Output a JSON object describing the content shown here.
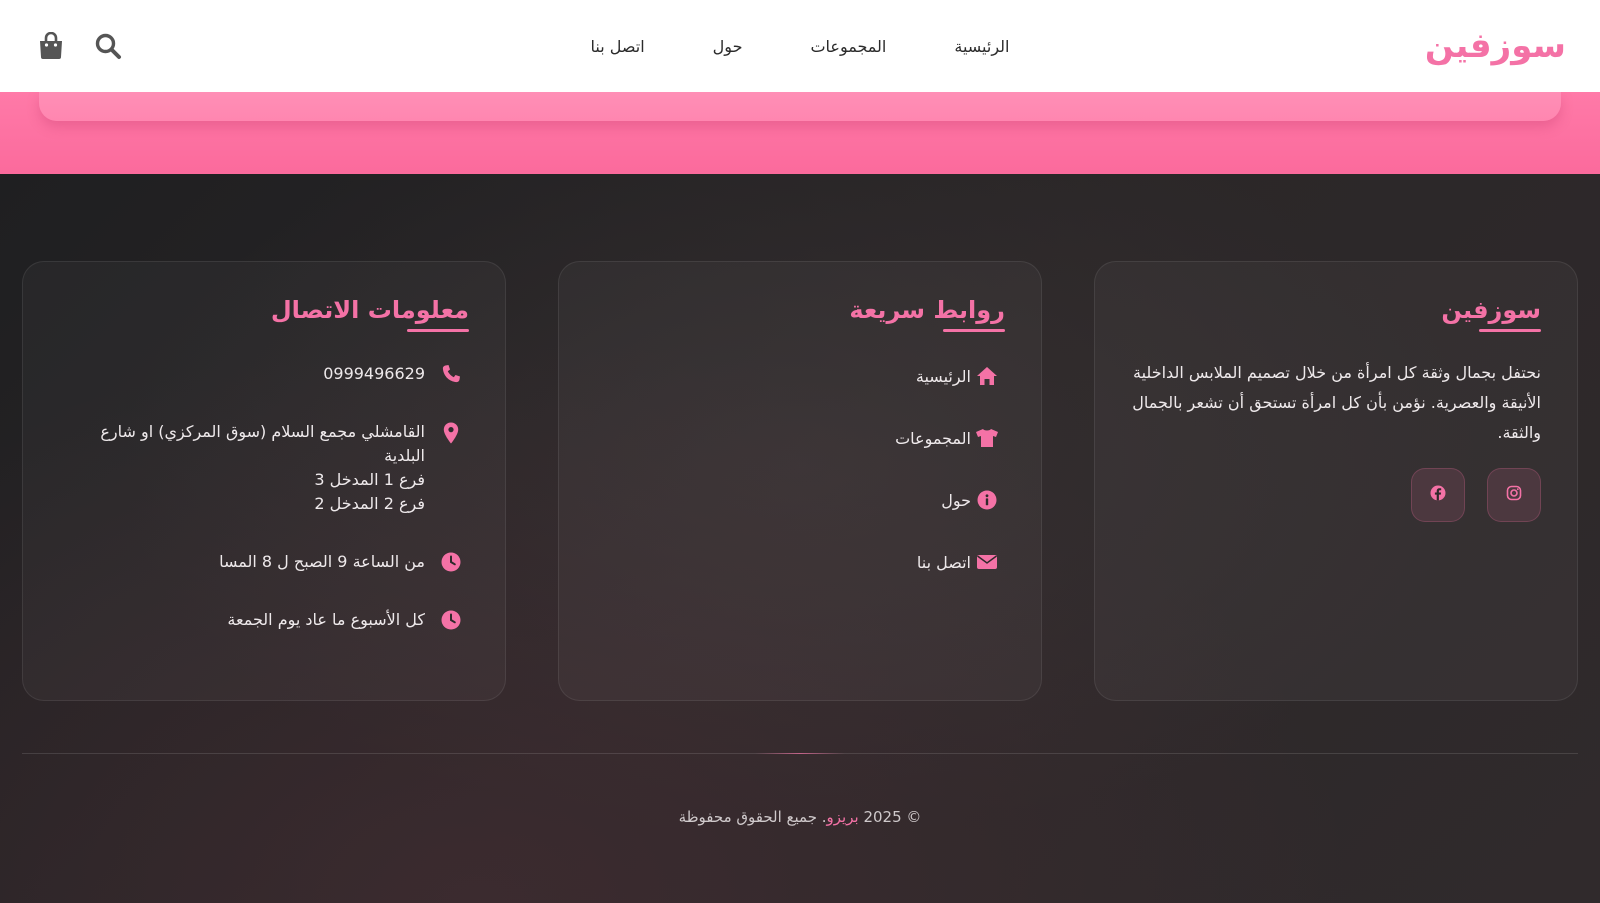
{
  "header": {
    "brand": "سوزفين",
    "nav": [
      "الرئيسية",
      "المجموعات",
      "حول",
      "اتصل بنا"
    ],
    "icons": [
      "search-icon",
      "shopping-bag-icon"
    ]
  },
  "about": {
    "title": "سوزفين",
    "text": "نحتفل بجمال وثقة كل امرأة من خلال تصميم الملابس الداخلية الأنيقة والعصرية. نؤمن بأن كل امرأة تستحق أن تشعر بالجمال والثقة.",
    "socials": [
      "instagram-icon",
      "facebook-icon"
    ]
  },
  "quick_links": {
    "title": "روابط سريعة",
    "items": [
      {
        "label": "الرئيسية",
        "icon": "home-icon"
      },
      {
        "label": "المجموعات",
        "icon": "shirt-icon"
      },
      {
        "label": "حول",
        "icon": "info-icon"
      },
      {
        "label": "اتصل بنا",
        "icon": "envelope-icon"
      }
    ]
  },
  "contact": {
    "title": "معلومات الاتصال",
    "phone": "0999496629",
    "address_1": "القامشلي مجمع السلام (سوق المركزي) او شارع البلدية",
    "address_2": "فرع 1 المدخل 3",
    "address_3": "فرع 2 المدخل 2",
    "hours": "من الساعة 9 الصبح ل 8 المسا",
    "days": "كل الأسبوع ما عاد يوم الجمعة"
  },
  "copyright": {
    "prefix": "© 2025",
    "brand": "بريزو",
    "suffix": ". جميع الحقوق محفوظة"
  },
  "colors": {
    "accent": "#f472a6",
    "band": "#fb6a9c",
    "footer_bg": "#2a2627"
  }
}
